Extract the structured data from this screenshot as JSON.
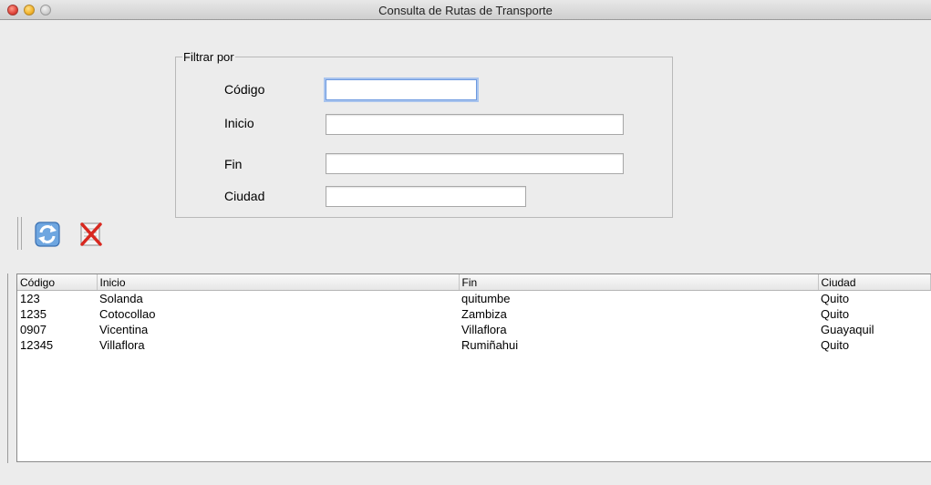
{
  "window": {
    "title": "Consulta de Rutas de Transporte"
  },
  "filter": {
    "legend": "Filtrar por",
    "fields": [
      {
        "label": "Código",
        "value": ""
      },
      {
        "label": "Inicio",
        "value": ""
      },
      {
        "label": "Fin",
        "value": ""
      },
      {
        "label": "Ciudad",
        "value": ""
      }
    ]
  },
  "toolbar": {
    "refresh_icon": "refresh-icon",
    "clear_icon": "clear-filter-icon"
  },
  "table": {
    "columns": [
      "Código",
      "Inicio",
      "Fin",
      "Ciudad"
    ],
    "rows": [
      [
        "123",
        "Solanda",
        "quitumbe",
        "Quito"
      ],
      [
        "1235",
        "Cotocollao",
        "Zambiza",
        "Quito"
      ],
      [
        "0907",
        "Vicentina",
        "Villaflora",
        "Guayaquil"
      ],
      [
        "12345",
        "Villaflora",
        "Rumiñahui",
        "Quito"
      ]
    ]
  },
  "colors": {
    "accent_focus": "#6d9ae0",
    "window_bg": "#ececec"
  }
}
